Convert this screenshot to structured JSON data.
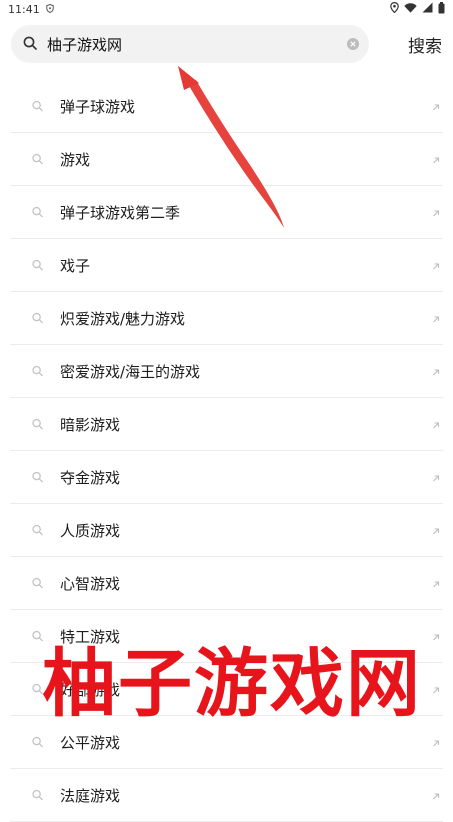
{
  "status_bar": {
    "time": "11:41"
  },
  "search": {
    "query": "柚子游戏网",
    "button_label": "搜索"
  },
  "suggestions": [
    "弹子球游戏",
    "游戏",
    "弹子球游戏第二季",
    "戏子",
    "炽爱游戏/魅力游戏",
    "密爱游戏/海王的游戏",
    "暗影游戏",
    "夺金游戏",
    "人质游戏",
    "心智游戏",
    "特工游戏",
    "好部游戏",
    "公平游戏",
    "法庭游戏"
  ],
  "watermark": {
    "text": "柚子游戏网",
    "color": "#e8141b"
  },
  "annotation_arrow": {
    "color": "#e53935"
  }
}
